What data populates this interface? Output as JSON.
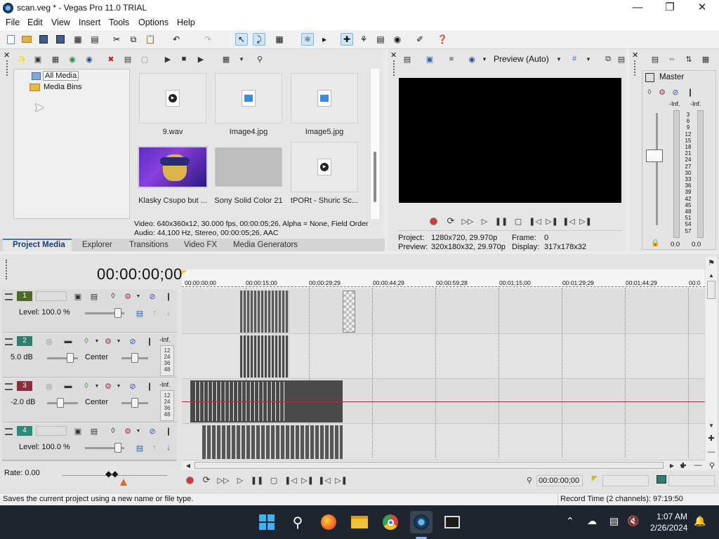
{
  "window": {
    "title": "scan.veg * - Vegas Pro 11.0 TRIAL"
  },
  "menu": [
    "File",
    "Edit",
    "View",
    "Insert",
    "Tools",
    "Options",
    "Help"
  ],
  "media": {
    "tree": {
      "all_media": "All Media",
      "media_bins": "Media Bins"
    },
    "items": [
      {
        "name": "9.wav",
        "kind": "audio"
      },
      {
        "name": "Image4.jpg",
        "kind": "image"
      },
      {
        "name": "Image5.jpg",
        "kind": "image"
      },
      {
        "name": "Klasky Csupo but ...",
        "kind": "video"
      },
      {
        "name": "Sony Solid Color 21",
        "kind": "solid"
      },
      {
        "name": "tPORt - Shuric Sc...",
        "kind": "audio"
      }
    ],
    "info_line1": "Video: 640x360x12, 30.000 fps, 00:00:05;26, Alpha = None, Field Order",
    "info_line2": "Audio: 44,100 Hz, Stereo, 00:00:05;26, AAC",
    "tabs": [
      "Project Media",
      "Explorer",
      "Transitions",
      "Video FX",
      "Media Generators"
    ]
  },
  "preview": {
    "mode": "Preview (Auto)",
    "project_label": "Project:",
    "project_value": "1280x720, 29.970p",
    "preview_label": "Preview:",
    "preview_value": "320x180x32, 29.970p",
    "frame_label": "Frame:",
    "frame_value": "0",
    "display_label": "Display:",
    "display_value": "317x178x32"
  },
  "master": {
    "label": "Master",
    "peak_left": "-Inf.",
    "peak_right": "-Inf.",
    "scale": [
      "3",
      "6",
      "9",
      "12",
      "15",
      "18",
      "21",
      "24",
      "27",
      "30",
      "33",
      "36",
      "39",
      "42",
      "45",
      "48",
      "51",
      "54",
      "57"
    ],
    "level_left": "0.0",
    "level_right": "0.0"
  },
  "timeline": {
    "timecode": "00:00:00;00",
    "ruler": [
      "00:00:00;00",
      "00:00:15;00",
      "00:00:29;29",
      "00:00:44;29",
      "00:00:59;28",
      "00:01:15;00",
      "00:01:29;29",
      "00:01:44;29",
      "00:0"
    ],
    "tracks": [
      {
        "num": "1",
        "type": "video",
        "level_label": "Level: 100.0 %"
      },
      {
        "num": "2",
        "type": "audio",
        "vol": "5.0 dB",
        "pan": "Center",
        "peak": "-Inf.",
        "meter": [
          "12",
          "24",
          "36",
          "48"
        ]
      },
      {
        "num": "3",
        "type": "audio",
        "vol": "-2.0 dB",
        "pan": "Center",
        "peak": "-Inf.",
        "meter": [
          "12",
          "24",
          "36",
          "48"
        ]
      },
      {
        "num": "4",
        "type": "video",
        "level_label": "Level: 100.0 %"
      }
    ],
    "rate": "Rate: 0.00",
    "cursor_time": "00:00:00;00"
  },
  "status": {
    "message": "Saves the current project using a new name or file type.",
    "record_time": "Record Time (2 channels): 97:19:50"
  },
  "taskbar": {
    "time": "1:07 AM",
    "date": "2/26/2024"
  },
  "colors": {
    "track1": "#4e6a2b",
    "track2": "#2f7d6b",
    "track3": "#8a2e3e",
    "track4": "#2d8a78",
    "preview_bg": "#000000"
  }
}
